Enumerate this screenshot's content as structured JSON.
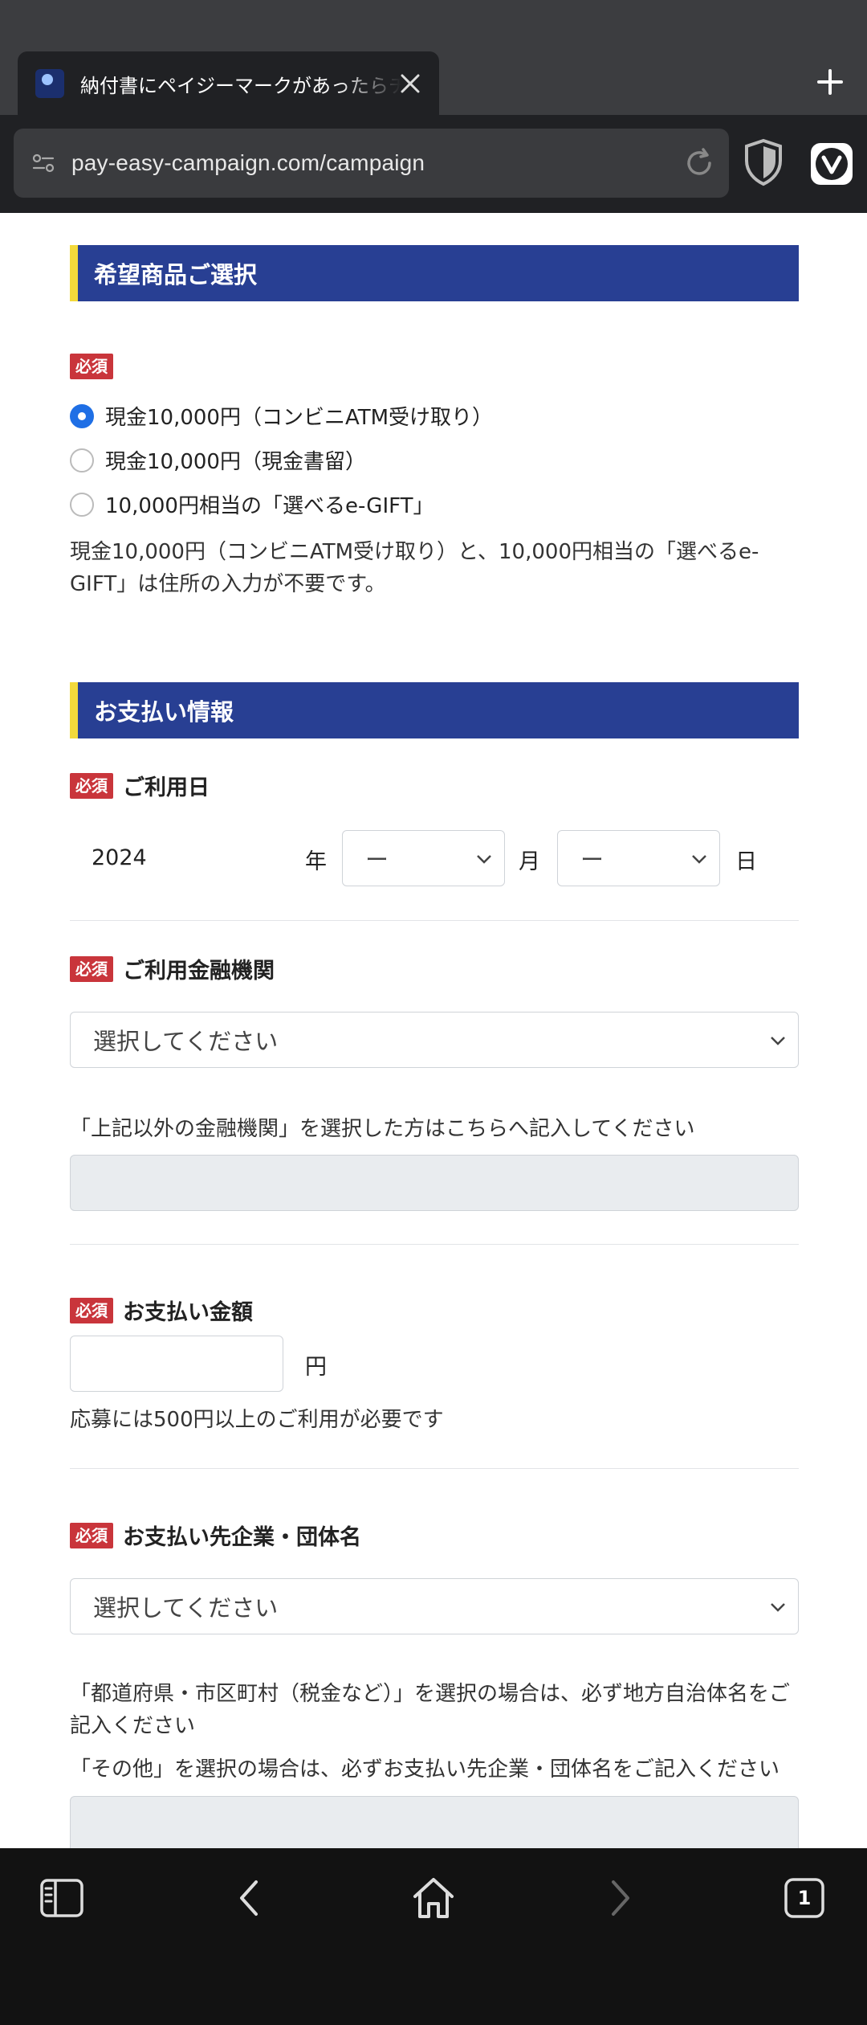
{
  "browser": {
    "tab_title": "納付書にペイジーマークがあったらチャンス",
    "url": "pay-easy-campaign.com/campaign",
    "tab_count": "1"
  },
  "section1": {
    "title": "希望商品ご選択",
    "required": "必須",
    "options": [
      {
        "label": "現金10,000円（コンビニATM受け取り）",
        "selected": true
      },
      {
        "label": "現金10,000円（現金書留）",
        "selected": false
      },
      {
        "label": "10,000円相当の「選べるe-GIFT」",
        "selected": false
      }
    ],
    "note": "現金10,000円（コンビニATM受け取り）と、10,000円相当の「選べるe-GIFT」は住所の入力が不要です。"
  },
  "section2": {
    "title": "お支払い情報",
    "usage_date": {
      "required": "必須",
      "label": "ご利用日",
      "year_value": "2024",
      "year_unit": "年",
      "month_value": "ー",
      "month_unit": "月",
      "day_value": "ー",
      "day_unit": "日"
    },
    "bank": {
      "required": "必須",
      "label": "ご利用金融機関",
      "select_value": "選択してください",
      "other_note": "「上記以外の金融機関」を選択した方はこちらへ記入してください"
    },
    "amount": {
      "required": "必須",
      "label": "お支払い金額",
      "unit": "円",
      "note": "応募には500円以上のご利用が必要です"
    },
    "payee": {
      "required": "必須",
      "label": "お支払い先企業・団体名",
      "select_value": "選択してください",
      "note1": "「都道府県・市区町村（税金など）」を選択の場合は、必ず地方自治体名をご記入ください",
      "note2": "「その他」を選択の場合は、必ずお支払い先企業・団体名をご記入ください"
    }
  },
  "icons": {
    "favicon": "pay-easy-favicon",
    "close": "close-icon",
    "new_tab": "plus-icon",
    "site_settings": "site-settings-icon",
    "reload": "reload-icon",
    "shield": "shield-icon",
    "vivaldi": "vivaldi-icon"
  },
  "colors": {
    "section_header": "#283f93",
    "section_accent": "#f3d93b",
    "required_badge": "#c9353b",
    "radio_selected": "#1f6fe5"
  }
}
